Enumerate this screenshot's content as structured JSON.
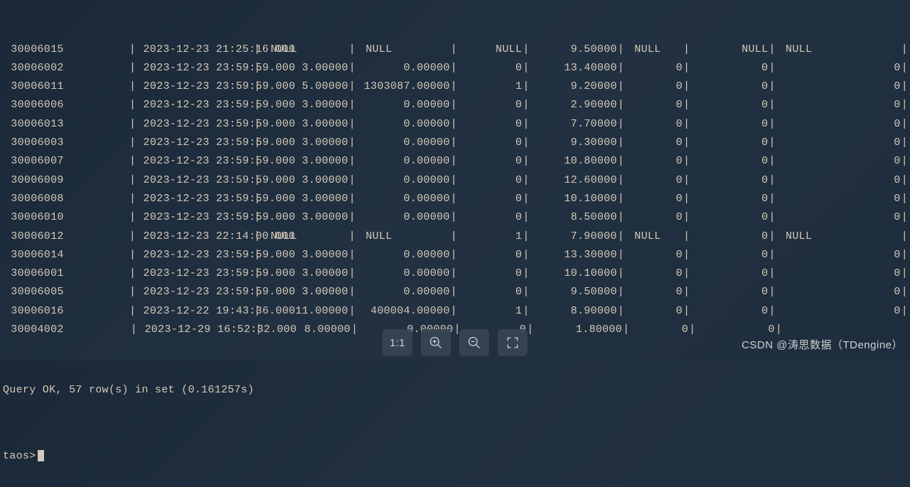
{
  "rows": [
    {
      "id": "30006015",
      "ts": "2023-12-23 21:25:16.000",
      "c1": "NULL",
      "c2": "NULL",
      "c3": "NULL",
      "c4": "9.50000",
      "c5": "NULL",
      "c6": "NULL",
      "c7": "NULL"
    },
    {
      "id": "30006002",
      "ts": "2023-12-23 23:59:59.000",
      "c1": "3.00000",
      "c2": "0.00000",
      "c3": "0",
      "c4": "13.40000",
      "c5": "0",
      "c6": "0",
      "c7": "0"
    },
    {
      "id": "30006011",
      "ts": "2023-12-23 23:59:59.000",
      "c1": "5.00000",
      "c2": "1303087.00000",
      "c3": "1",
      "c4": "9.20000",
      "c5": "0",
      "c6": "0",
      "c7": "0"
    },
    {
      "id": "30006006",
      "ts": "2023-12-23 23:59:59.000",
      "c1": "3.00000",
      "c2": "0.00000",
      "c3": "0",
      "c4": "2.90000",
      "c5": "0",
      "c6": "0",
      "c7": "0"
    },
    {
      "id": "30006013",
      "ts": "2023-12-23 23:59:59.000",
      "c1": "3.00000",
      "c2": "0.00000",
      "c3": "0",
      "c4": "7.70000",
      "c5": "0",
      "c6": "0",
      "c7": "0"
    },
    {
      "id": "30006003",
      "ts": "2023-12-23 23:59:59.000",
      "c1": "3.00000",
      "c2": "0.00000",
      "c3": "0",
      "c4": "9.30000",
      "c5": "0",
      "c6": "0",
      "c7": "0"
    },
    {
      "id": "30006007",
      "ts": "2023-12-23 23:59:59.000",
      "c1": "3.00000",
      "c2": "0.00000",
      "c3": "0",
      "c4": "10.80000",
      "c5": "0",
      "c6": "0",
      "c7": "0"
    },
    {
      "id": "30006009",
      "ts": "2023-12-23 23:59:59.000",
      "c1": "3.00000",
      "c2": "0.00000",
      "c3": "0",
      "c4": "12.60000",
      "c5": "0",
      "c6": "0",
      "c7": "0"
    },
    {
      "id": "30006008",
      "ts": "2023-12-23 23:59:59.000",
      "c1": "3.00000",
      "c2": "0.00000",
      "c3": "0",
      "c4": "10.10000",
      "c5": "0",
      "c6": "0",
      "c7": "0"
    },
    {
      "id": "30006010",
      "ts": "2023-12-23 23:59:59.000",
      "c1": "3.00000",
      "c2": "0.00000",
      "c3": "0",
      "c4": "8.50000",
      "c5": "0",
      "c6": "0",
      "c7": "0"
    },
    {
      "id": "30006012",
      "ts": "2023-12-23 22:14:00.000",
      "c1": "NULL",
      "c2": "NULL",
      "c3": "1",
      "c4": "7.90000",
      "c5": "NULL",
      "c6": "0",
      "c7": "NULL"
    },
    {
      "id": "30006014",
      "ts": "2023-12-23 23:59:59.000",
      "c1": "3.00000",
      "c2": "0.00000",
      "c3": "0",
      "c4": "13.30000",
      "c5": "0",
      "c6": "0",
      "c7": "0"
    },
    {
      "id": "30006001",
      "ts": "2023-12-23 23:59:59.000",
      "c1": "3.00000",
      "c2": "0.00000",
      "c3": "0",
      "c4": "10.10000",
      "c5": "0",
      "c6": "0",
      "c7": "0"
    },
    {
      "id": "30006005",
      "ts": "2023-12-23 23:59:59.000",
      "c1": "3.00000",
      "c2": "0.00000",
      "c3": "0",
      "c4": "9.50000",
      "c5": "0",
      "c6": "0",
      "c7": "0"
    },
    {
      "id": "30006016",
      "ts": "2023-12-22 19:43:36.000",
      "c1": "11.00000",
      "c2": "400004.00000",
      "c3": "1",
      "c4": "8.90000",
      "c5": "0",
      "c6": "0",
      "c7": "0"
    },
    {
      "id": "30004002",
      "ts": "2023-12-29 16:52:32.000",
      "c1": "8.00000",
      "c2": "0.00000",
      "c3": "0",
      "c4": "1.80000",
      "c5": "0",
      "c6": "0",
      "c7": ""
    }
  ],
  "status": "Query OK, 57 row(s) in set (0.161257s)",
  "prompt": "taos>",
  "toolbar": {
    "ratio": "1:1"
  },
  "watermark": "CSDN @涛思数据（TDengine）"
}
